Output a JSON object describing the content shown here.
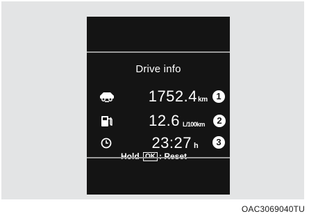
{
  "screen": {
    "title": "Drive info",
    "rows": [
      {
        "icon": "car-distance-icon",
        "value": "1752.4",
        "unit": "km",
        "marker": "1"
      },
      {
        "icon": "fuel-pump-icon",
        "value": "12.6",
        "unit": "L/100km",
        "marker": "2"
      },
      {
        "icon": "clock-icon",
        "value": "23:27",
        "unit": "h",
        "marker": "3"
      }
    ],
    "hold": {
      "prefix": "Hold",
      "button": "OK",
      "suffix": ": Reset"
    }
  },
  "caption": "OAC3069040TU",
  "colors": {
    "screen_bg": "#141414",
    "frame_bg": "#e3e4e5",
    "separator": "#9a9a9a",
    "text": "#ffffff"
  }
}
